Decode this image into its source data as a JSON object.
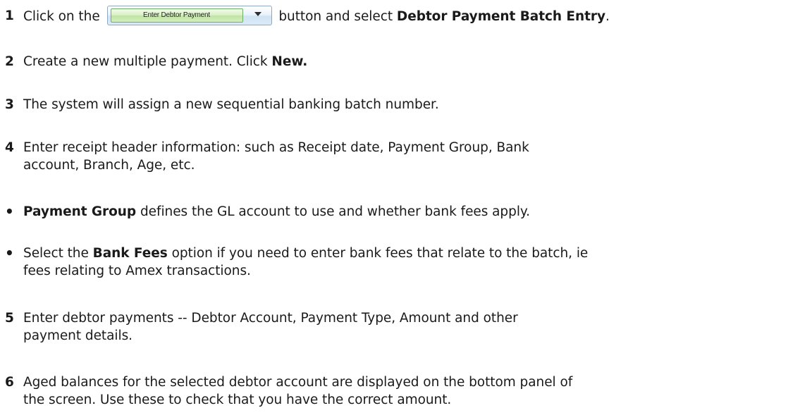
{
  "steps": [
    {
      "marker": "1",
      "before_button": "Click on the",
      "button_label": "Enter Debtor Payment",
      "button_arrow_icon": "chevron-down-icon",
      "after_button": "button and select",
      "bold": "Debtor Payment Batch Entry",
      "suffix": "."
    },
    {
      "marker": "2",
      "text": "Create a new multiple payment. Click",
      "bold": "New."
    },
    {
      "marker": "3",
      "text": "The system will assign a new sequential banking batch number."
    },
    {
      "marker": "4",
      "line1": "Enter receipt header information: such as Receipt date, Payment Group, Bank",
      "line2": "account, Branch, Age, etc."
    },
    {
      "marker": "•",
      "bold": "Payment Group",
      "text": "defines the GL account to use and whether bank fees apply."
    },
    {
      "marker": "•",
      "prefix": "Select the",
      "bold": "Bank Fees",
      "line1_rest": "option if you need to enter bank fees that relate to the batch, ie",
      "line2": "fees relating to Amex transactions."
    },
    {
      "marker": "5",
      "line1": "Enter debtor payments -- Debtor Account, Payment Type, Amount and other",
      "line2": "payment details."
    },
    {
      "marker": "6",
      "line1": "Aged balances for the selected debtor account are displayed on the bottom panel of",
      "line2": "the screen. Use these to check that you have the correct amount."
    }
  ]
}
